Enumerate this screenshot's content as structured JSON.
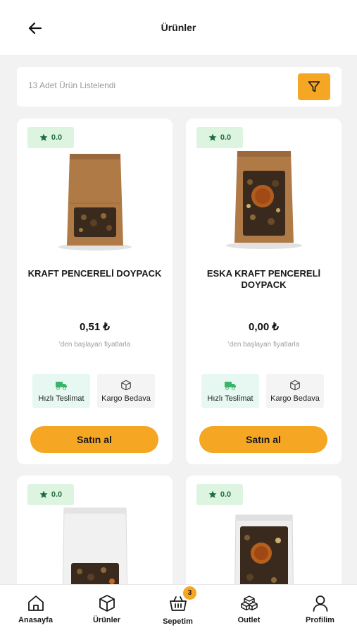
{
  "header": {
    "title": "Ürünler"
  },
  "results": {
    "text": "13 Adet Ürün Listelendi"
  },
  "colors": {
    "accent": "#f5a623",
    "rating_bg": "#dcf4e0",
    "rating_fg": "#1c6e3c",
    "fast_bg": "#e6f8f1"
  },
  "products": [
    {
      "rating": "0.0",
      "name": "KRAFT PENCERELİ DOYPACK",
      "price": "0,51 ₺",
      "price_note": "'den başlayan fiyatlarla",
      "feature_fast": "Hızlı Teslimat",
      "feature_free": "Kargo Bedava",
      "buy_label": "Satın al"
    },
    {
      "rating": "0.0",
      "name": "ESKA KRAFT PENCERELİ DOYPACK",
      "price": "0,00 ₺",
      "price_note": "'den başlayan fiyatlarla",
      "feature_fast": "Hızlı Teslimat",
      "feature_free": "Kargo Bedava",
      "buy_label": "Satın al"
    },
    {
      "rating": "0.0"
    },
    {
      "rating": "0.0"
    }
  ],
  "nav": {
    "home": "Anasayfa",
    "products": "Ürünler",
    "cart": "Sepetim",
    "cart_count": "3",
    "outlet": "Outlet",
    "profile": "Profilim"
  }
}
